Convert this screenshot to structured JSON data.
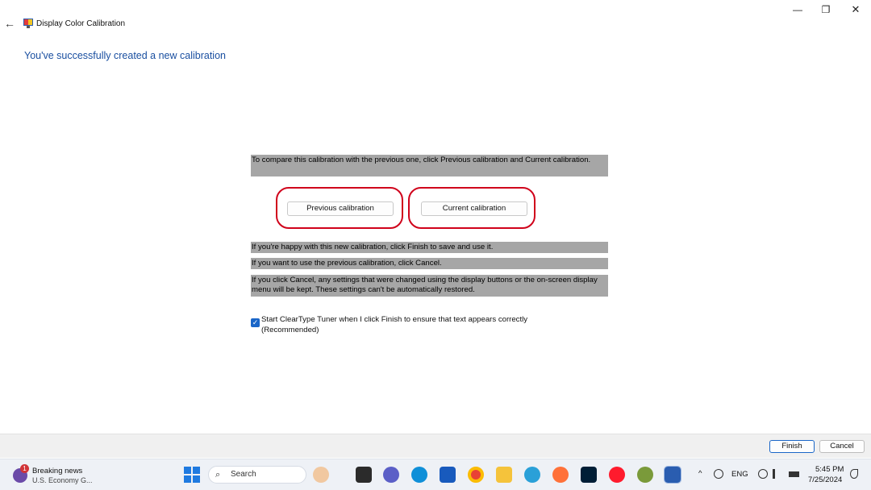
{
  "window": {
    "title": "Display Color Calibration",
    "back_icon": "←",
    "minimize_icon": "—",
    "maximize_icon": "❐",
    "close_icon": "✕"
  },
  "heading": "You've successfully created a new calibration",
  "panels": {
    "compare": "To compare this calibration with the previous one, click Previous calibration and Current calibration.",
    "happy": "If you're happy with this new calibration, click Finish to save and use it.",
    "previous": "If you want to use the previous calibration, click Cancel.",
    "cancel_note": "If you click Cancel, any settings that were changed using the display buttons or the on-screen display menu will be kept. These settings can't be automatically restored."
  },
  "buttons": {
    "previous_calibration": "Previous calibration",
    "current_calibration": "Current calibration",
    "finish": "Finish",
    "cancel": "Cancel"
  },
  "cleartype": {
    "checked": true,
    "check_glyph": "✓",
    "label": "Start ClearType Tuner when I click Finish to ensure that text appears correctly (Recommended)"
  },
  "highlight_color": "#d0021b",
  "taskbar": {
    "news": {
      "badge": "1",
      "title": "Breaking news",
      "subtitle": "U.S. Economy G..."
    },
    "search": {
      "icon": "⌕",
      "label": "Search"
    },
    "apps": [
      "copilot-icon",
      "file-explorer-icon",
      "teams-icon",
      "edge-icon",
      "word-icon",
      "chrome-icon",
      "folder-icon",
      "telegram-icon",
      "firefox-icon",
      "photoshop-icon",
      "opera-icon",
      "app-icon",
      "calibration-app-icon"
    ],
    "tray": {
      "chevron": "^",
      "language": "ENG",
      "time": "5:45 PM",
      "date": "7/25/2024"
    }
  }
}
